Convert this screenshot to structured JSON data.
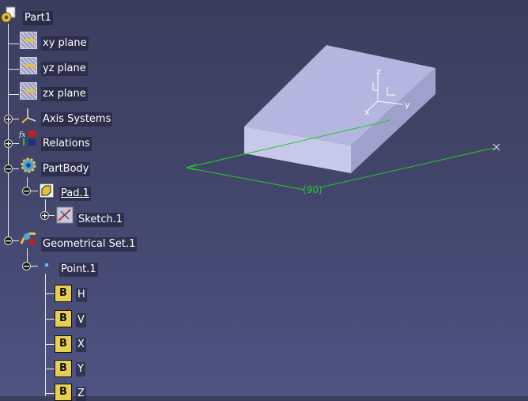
{
  "tree": {
    "root": {
      "label": "Part1",
      "icon": "part-icon"
    },
    "items": [
      {
        "key": "xy",
        "label": "xy plane",
        "icon": "plane-icon"
      },
      {
        "key": "yz",
        "label": "yz plane",
        "icon": "plane-icon"
      },
      {
        "key": "zx",
        "label": "zx plane",
        "icon": "plane-icon"
      },
      {
        "key": "axis",
        "label": "Axis Systems",
        "icon": "axis-system-icon"
      },
      {
        "key": "relations",
        "label": "Relations",
        "icon": "relations-icon"
      },
      {
        "key": "partbody",
        "label": "PartBody",
        "icon": "gear-body-icon"
      },
      {
        "key": "pad",
        "label": "Pad.1",
        "icon": "pad-icon"
      },
      {
        "key": "sketch",
        "label": "Sketch.1",
        "icon": "sketch-icon"
      },
      {
        "key": "geoset",
        "label": "Geometrical Set.1",
        "icon": "geometrical-set-icon"
      },
      {
        "key": "point",
        "label": "Point.1",
        "icon": "point-icon"
      },
      {
        "key": "h",
        "label": "H",
        "icon": "parameter-icon"
      },
      {
        "key": "v",
        "label": "V",
        "icon": "parameter-icon"
      },
      {
        "key": "x",
        "label": "X",
        "icon": "parameter-icon"
      },
      {
        "key": "y",
        "label": "Y",
        "icon": "parameter-icon"
      },
      {
        "key": "z",
        "label": "Z",
        "icon": "parameter-icon"
      }
    ],
    "param_letter": "B"
  },
  "viewport": {
    "dimension_label": "(90)",
    "axis_labels": {
      "x": "x",
      "y": "y",
      "z": "z"
    },
    "box_top_color": "#b4b6e0",
    "box_front_color": "#c8c9ea",
    "box_side_color": "#9fa1cc",
    "dimension_color": "#22cc22"
  }
}
